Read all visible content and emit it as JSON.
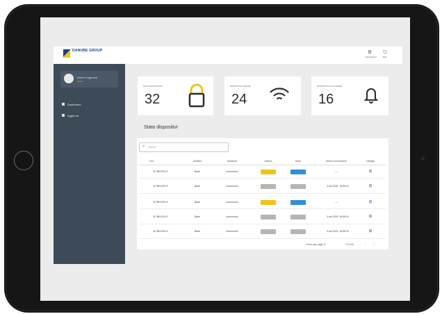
{
  "header": {
    "logo_name": "DANUBE GROUP",
    "logo_sub": "",
    "icons": [
      {
        "name": "gear-icon",
        "label": "Impostazioni"
      },
      {
        "name": "exit-icon",
        "label": "Esci"
      }
    ]
  },
  "sidebar": {
    "user_name": "Nome Cognome",
    "user_role": "Utente",
    "items": [
      {
        "label": "Dashboard",
        "icon": "dashboard-icon"
      },
      {
        "label": "Aggiorna",
        "icon": "update-icon"
      }
    ]
  },
  "cards": [
    {
      "title": "NUOVI DISPOSITIVI",
      "value": "32",
      "icon": "lock-icon"
    },
    {
      "title": "DISPOSITIVI ONLINE",
      "value": "24",
      "icon": "wifi-icon"
    },
    {
      "title": "DISPOSITIVI IN ALLARME",
      "value": "16",
      "icon": "bell-icon"
    }
  ],
  "section_title": "Stato dispositivi",
  "search": {
    "placeholder": "Cerca"
  },
  "table": {
    "columns": [
      "Nro",
      "Modello",
      "Matricola",
      "Allarmi",
      "Stato",
      "Ultima connessione",
      "Dettagli"
    ],
    "rows": [
      {
        "nro": "3L7BKOGH-F",
        "modello": "Base",
        "matricola": "xxxxxxxxxx",
        "allarmi": "warning",
        "stato": "online",
        "ultima": "—"
      },
      {
        "nro": "3L7BKOGH-F",
        "modello": "Base",
        "matricola": "xxxxxxxxxx",
        "allarmi": "none",
        "stato": "offline",
        "ultima": "3 set 2020, 15:55:10"
      },
      {
        "nro": "3L7BKOGH-F",
        "modello": "Base",
        "matricola": "xxxxxxxxxx",
        "allarmi": "warning",
        "stato": "online",
        "ultima": "—"
      },
      {
        "nro": "3L7BKOGH-F",
        "modello": "Base",
        "matricola": "xxxxxxxxxx",
        "allarmi": "none",
        "stato": "offline",
        "ultima": "3 set 2020, 15:55:10"
      },
      {
        "nro": "3L7BKOGH-F",
        "modello": "Base",
        "matricola": "xxxxxxxxxx",
        "allarmi": "none",
        "stato": "offline",
        "ultima": "3 set 2020, 15:55:10"
      }
    ]
  },
  "footer": {
    "rows_per_page": "Rows per page: 5",
    "range": "1-5 of 8",
    "prev_icon": "chevron-left-icon",
    "next_icon": "chevron-right-icon"
  },
  "colors": {
    "sidebar": "#3d4b58",
    "warning": "#f2c31b",
    "online": "#2f8fd8",
    "offline": "#b5b5b5",
    "card_icon_top": "#f2c31b"
  }
}
